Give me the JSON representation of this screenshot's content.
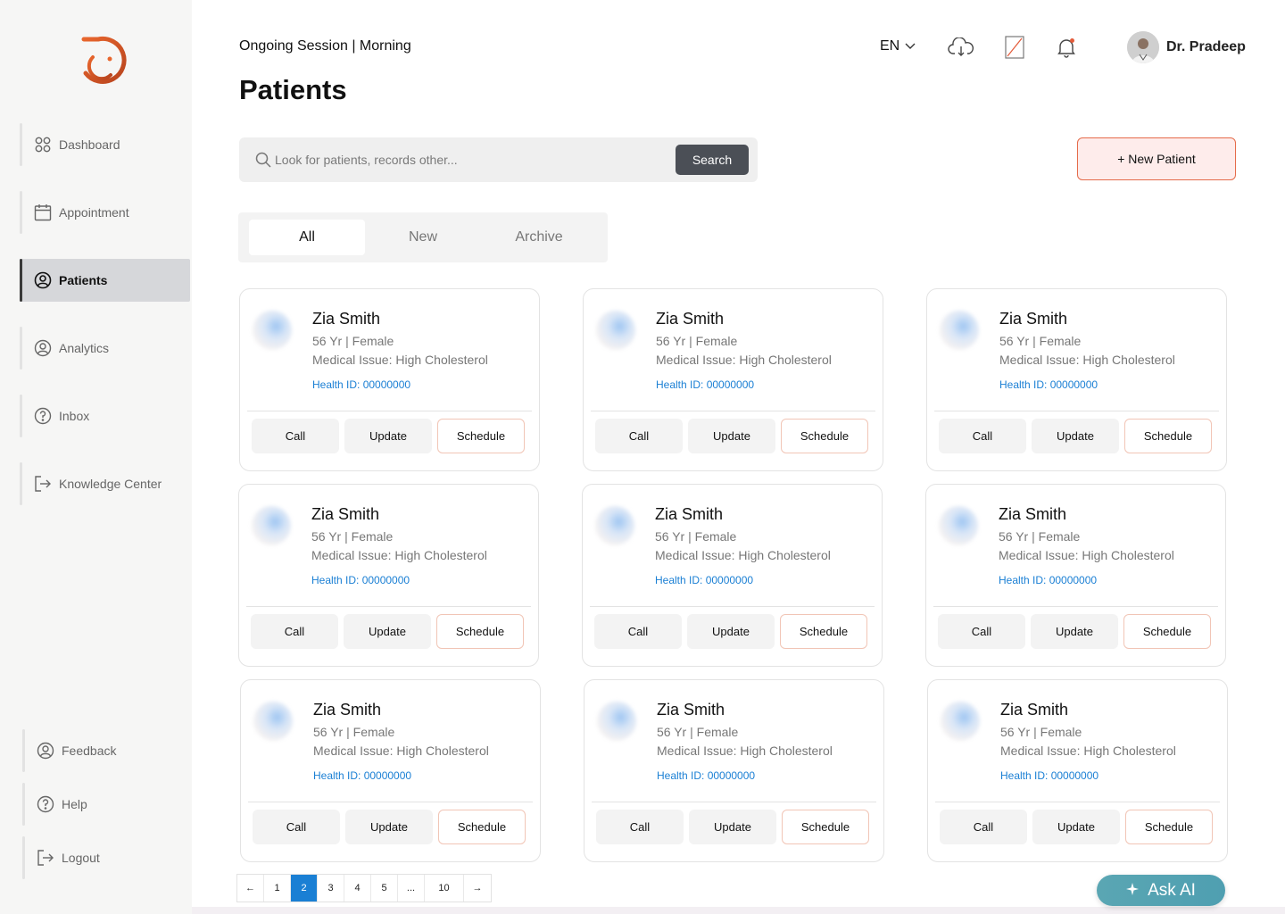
{
  "sidebar": {
    "items": [
      {
        "label": "Dashboard",
        "icon": "grid-icon"
      },
      {
        "label": "Appointment",
        "icon": "calendar-icon"
      },
      {
        "label": "Patients",
        "icon": "user-circle-icon",
        "active": true
      },
      {
        "label": "Analytics",
        "icon": "user-circle-icon"
      },
      {
        "label": "Inbox",
        "icon": "question-circle-icon"
      },
      {
        "label": "Knowledge Center",
        "icon": "exit-icon"
      }
    ],
    "bottom_items": [
      {
        "label": "Feedback",
        "icon": "user-circle-icon"
      },
      {
        "label": "Help",
        "icon": "question-circle-icon"
      },
      {
        "label": "Logout",
        "icon": "exit-icon"
      }
    ]
  },
  "header": {
    "session_label": "Ongoing Session",
    "session_value": "Morning",
    "title": "Patients",
    "language": "EN",
    "user_name": "Dr. Pradeep"
  },
  "search": {
    "placeholder": "Look for patients, records other...",
    "button_label": "Search"
  },
  "new_patient_label": "+ New Patient",
  "tabs": [
    {
      "label": "All",
      "active": true
    },
    {
      "label": "New"
    },
    {
      "label": "Archive"
    }
  ],
  "patients": [
    {
      "name": "Zia Smith",
      "age": "56 Yr",
      "gender": "Female",
      "issue": "Medical Issue: High Cholesterol",
      "health_id": "Health ID: 00000000"
    },
    {
      "name": "Zia Smith",
      "age": "56 Yr",
      "gender": "Female",
      "issue": "Medical Issue: High Cholesterol",
      "health_id": "Health ID: 00000000"
    },
    {
      "name": "Zia Smith",
      "age": "56 Yr",
      "gender": "Female",
      "issue": "Medical Issue: High Cholesterol",
      "health_id": "Health ID: 00000000"
    },
    {
      "name": "Zia Smith",
      "age": "56 Yr",
      "gender": "Female",
      "issue": "Medical Issue: High Cholesterol",
      "health_id": "Health ID: 00000000"
    },
    {
      "name": "Zia Smith",
      "age": "56 Yr",
      "gender": "Female",
      "issue": "Medical Issue: High Cholesterol",
      "health_id": "Health ID: 00000000"
    },
    {
      "name": "Zia Smith",
      "age": "56 Yr",
      "gender": "Female",
      "issue": "Medical Issue: High Cholesterol",
      "health_id": "Health ID: 00000000"
    },
    {
      "name": "Zia Smith",
      "age": "56 Yr",
      "gender": "Female",
      "issue": "Medical Issue: High Cholesterol",
      "health_id": "Health ID: 00000000"
    },
    {
      "name": "Zia Smith",
      "age": "56 Yr",
      "gender": "Female",
      "issue": "Medical Issue: High Cholesterol",
      "health_id": "Health ID: 00000000"
    },
    {
      "name": "Zia Smith",
      "age": "56 Yr",
      "gender": "Female",
      "issue": "Medical Issue: High Cholesterol",
      "health_id": "Health ID: 00000000"
    }
  ],
  "card_actions": {
    "call": "Call",
    "update": "Update",
    "schedule": "Schedule"
  },
  "pagination": {
    "prev": "←",
    "pages": [
      "1",
      "2",
      "3",
      "4",
      "5",
      "...",
      "10"
    ],
    "current": "2",
    "next": "→"
  },
  "ask_ai_label": "Ask AI",
  "colors": {
    "accent": "#e56b4a",
    "link": "#1a7fd4",
    "active_nav": "#d6d7da",
    "search_button": "#4b4f56",
    "ask_ai": "#5aa6b3"
  }
}
